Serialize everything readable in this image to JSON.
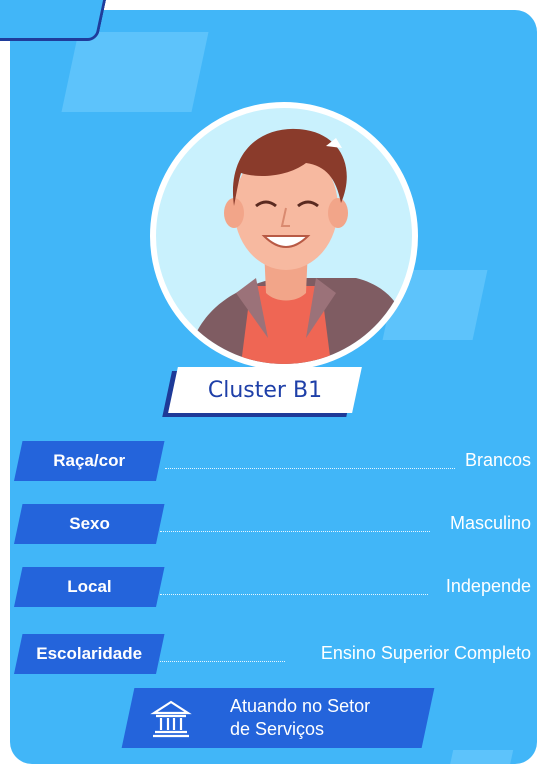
{
  "cluster": {
    "title": "Cluster B1"
  },
  "attributes": [
    {
      "label": "Raça/cor",
      "value": "Brancos"
    },
    {
      "label": "Sexo",
      "value": "Masculino"
    },
    {
      "label": "Local",
      "value": "Independe"
    },
    {
      "label": "Escolaridade",
      "value": "Ensino Superior Completo"
    }
  ],
  "sector": {
    "line1": "Atuando no Setor",
    "line2": "de Serviços",
    "icon": "bank-building-icon"
  },
  "colors": {
    "card": "#41b6f8",
    "label_bg": "#2464db",
    "title_text": "#1e3fa8",
    "accent_shadow": "#1e3a98",
    "avatar_bg": "#c9f1fd"
  }
}
